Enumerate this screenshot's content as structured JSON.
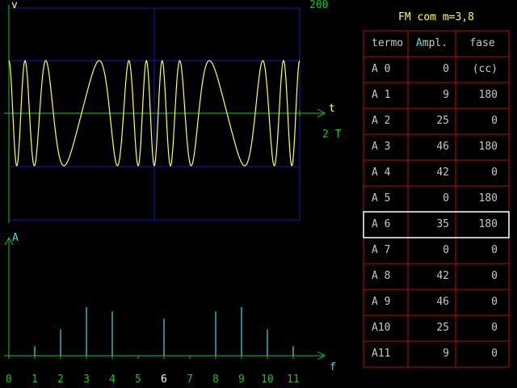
{
  "colors": {
    "frame": "#1818b0",
    "axis": "#20c020",
    "wave": "#ffff60",
    "spectrum": "#40e0f0",
    "grid": "#b01010",
    "highlight": "#ffffff",
    "title": "#ffff48"
  },
  "oscilloscope": {
    "y_label": "v",
    "x_label": "t",
    "scale_label": "200",
    "period_label": "2 T"
  },
  "spectrum": {
    "y_label": "A",
    "x_label": "f",
    "harmonics": [
      "0",
      "1",
      "2",
      "3",
      "4",
      "5",
      "6",
      "7",
      "8",
      "9",
      "10",
      "11"
    ],
    "selected_index": 6,
    "chart_data": {
      "type": "bar",
      "categories": [
        "0",
        "1",
        "2",
        "3",
        "4",
        "5",
        "6",
        "7",
        "8",
        "9",
        "10",
        "11"
      ],
      "values": [
        0,
        9,
        25,
        46,
        42,
        0,
        35,
        0,
        42,
        46,
        25,
        9
      ]
    }
  },
  "table": {
    "title": "FM com m=3,8",
    "headers": {
      "term": "termo",
      "amp_first": "A",
      "amp_rest": "mpl.",
      "phase": "fase"
    },
    "rows": [
      {
        "term": "A 0",
        "amp": "0",
        "phase": "(cc)"
      },
      {
        "term": "A 1",
        "amp": "9",
        "phase": "180"
      },
      {
        "term": "A 2",
        "amp": "25",
        "phase": "0"
      },
      {
        "term": "A 3",
        "amp": "46",
        "phase": "180"
      },
      {
        "term": "A 4",
        "amp": "42",
        "phase": "0"
      },
      {
        "term": "A 5",
        "amp": "0",
        "phase": "180"
      },
      {
        "term": "A 6",
        "amp": "35",
        "phase": "180"
      },
      {
        "term": "A 7",
        "amp": "0",
        "phase": "0"
      },
      {
        "term": "A 8",
        "amp": "42",
        "phase": "0"
      },
      {
        "term": "A 9",
        "amp": "46",
        "phase": "0"
      },
      {
        "term": "A10",
        "amp": "25",
        "phase": "0"
      },
      {
        "term": "A11",
        "amp": "9",
        "phase": "0"
      }
    ],
    "selected_row": 6
  }
}
